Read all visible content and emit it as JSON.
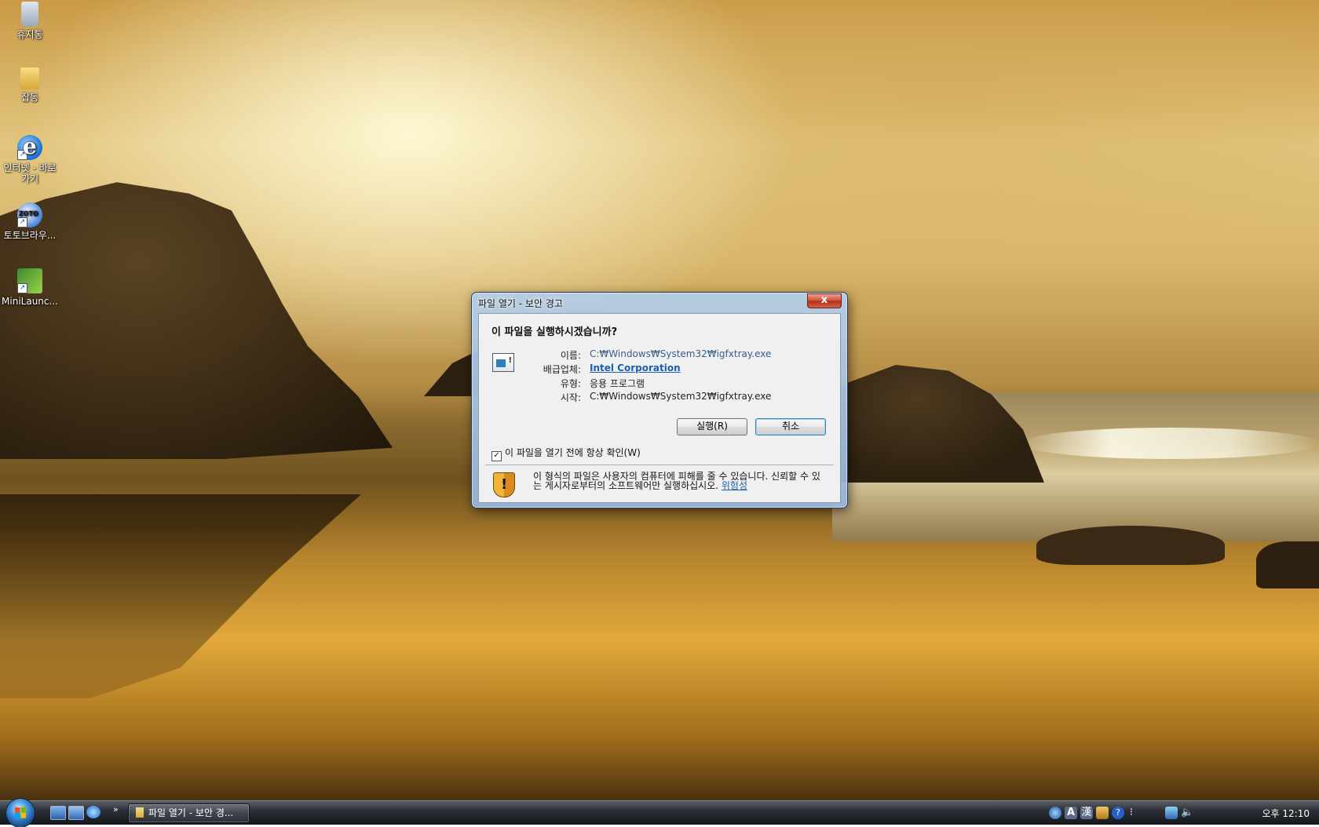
{
  "desktop": {
    "icons": [
      {
        "label": "휴지통",
        "icon": "recycle-bin-icon"
      },
      {
        "label": "잡동",
        "icon": "folder-icon"
      },
      {
        "label": "인터넷 - 바로 가기",
        "icon": "internet-explorer-icon"
      },
      {
        "label": "토토브라우...",
        "icon": "zoto-browser-icon"
      },
      {
        "label": "MiniLaunc...",
        "icon": "minilauncher-icon"
      }
    ]
  },
  "dialog": {
    "title": "파일 열기 - 보안 경고",
    "close_label": "x",
    "question": "이 파일을 실행하시겠습니까?",
    "fields": {
      "name_label": "이름:",
      "name_value": "C:₩Windows₩System32₩igfxtray.exe",
      "publisher_label": "배급업체:",
      "publisher_value": "Intel Corporation",
      "type_label": "유형:",
      "type_value": "응용 프로그램",
      "from_label": "시작:",
      "from_value": "C:₩Windows₩System32₩igfxtray.exe"
    },
    "run_button": "실행(R)",
    "cancel_button": "취소",
    "checkbox_label": "이 파일을 열기 전에 항상 확인(W)",
    "checkbox_checked": true,
    "warning_text": "이 형식의 파일은 사용자의 컴퓨터에 피해를 줄 수 있습니다. 신뢰할 수 있는 게시자로부터의 소프트웨어만 실행하십시오.",
    "warning_link": "위험성"
  },
  "taskbar": {
    "quicklaunch_more": "»",
    "task_button": "파일 열기 - 보안 경...",
    "tray": {
      "ime_letter": "A",
      "hanja": "漢",
      "help": "?",
      "clock": "오후 12:10"
    }
  }
}
